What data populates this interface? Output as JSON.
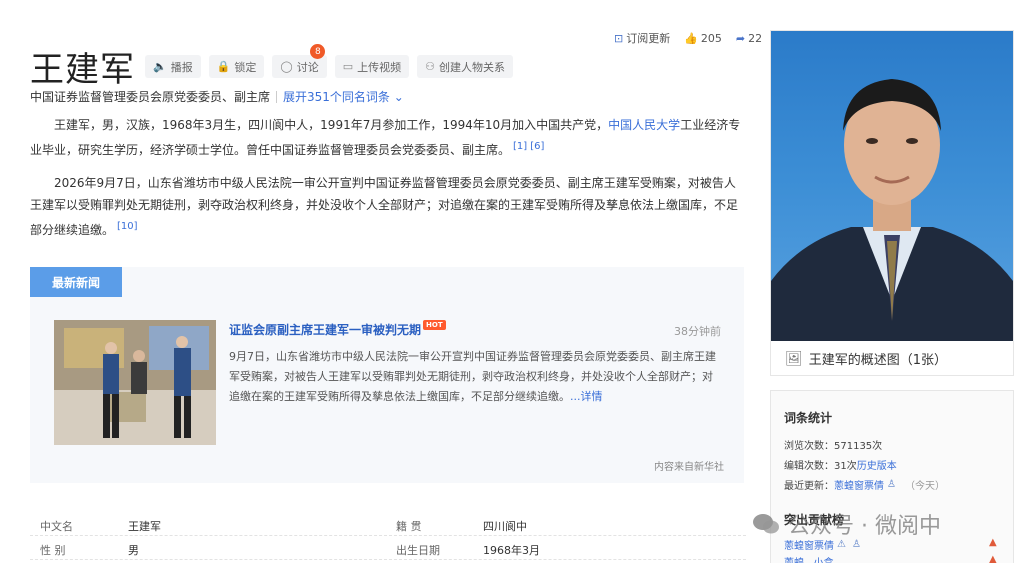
{
  "header": {
    "title": "王建军",
    "tools": [
      {
        "label": "播报",
        "icon": "speaker-icon"
      },
      {
        "label": "锁定",
        "icon": "lock-icon"
      },
      {
        "label": "讨论",
        "icon": "chat-icon",
        "badge": "8"
      },
      {
        "label": "上传视频",
        "icon": "video-icon"
      },
      {
        "label": "创建人物关系",
        "icon": "people-icon"
      }
    ],
    "subscribe_label": "订阅更新",
    "like_count": "205",
    "share_count": "22"
  },
  "subtitle": {
    "description": "中国证券监督管理委员会原党委委员、副主席",
    "expand_label": "展开351个同名词条"
  },
  "intro": {
    "p1_text": "王建军，男，汉族，1968年3月生，四川阆中人，1991年7月参加工作，1994年10月加入中国共产党，",
    "p1_link": "中国人民大学",
    "p1_rest": "工业经济专业毕业，研究生学历，经济学硕士学位。曾任中国证券监督管理委员会党委委员、副主席。",
    "p1_ref1": "[1]",
    "p1_ref2": "[6]",
    "p2_text": "2026年9月7日，山东省潍坊市中级人民法院一审公开宣判中国证券监督管理委员会原党委委员、副主席王建军受贿案，对被告人王建军以受贿罪判处无期徒刑，剥夺政治权利终身，并处没收个人全部财产；对追缴在案的王建军受贿所得及孳息依法上缴国库，不足部分继续追缴。",
    "p2_ref": "[10]"
  },
  "news": {
    "tab_label": "最新新闻",
    "title": "证监会原副主席王建军一审被判无期",
    "hot_label": "HOT",
    "time": "38分钟前",
    "body": "9月7日，山东省潍坊市中级人民法院一审公开宣判中国证券监督管理委员会原党委委员、副主席王建军受贿案，对被告人王建军以受贿罪判处无期徒刑，剥夺政治权利终身，并处没收个人全部财产；对追缴在案的王建军受贿所得及孳息依法上缴国库，不足部分继续追缴。",
    "more_label": "...详情",
    "source": "内容来自新华社"
  },
  "info": {
    "rows": [
      {
        "label1": "中文名",
        "value1": "王建军",
        "label2": "籍    贯",
        "value2": "四川阆中"
      },
      {
        "label1": "性    别",
        "value1": "男",
        "label2": "出生日期",
        "value2": "1968年3月"
      }
    ]
  },
  "photo": {
    "caption": "王建军的概述图（1张）"
  },
  "stats": {
    "title": "词条统计",
    "views_label": "浏览次数：",
    "views_value": "571135次",
    "edits_label": "编辑次数：",
    "edits_value": "31次",
    "history_label": "历史版本",
    "updated_label": "最近更新：",
    "updated_user": "蔥蝗窗票倩",
    "updated_time": "（今天）",
    "contrib_title": "突出贡献榜",
    "contrib_user": "蔥蝗窗票倩",
    "contrib_user2": "蔥蝗...小盒"
  },
  "watermark": {
    "text": "公众号 · 微阅中"
  },
  "colors": {
    "link": "#3a6fd8",
    "tab": "#5b9de8",
    "badge": "#f05a28"
  }
}
